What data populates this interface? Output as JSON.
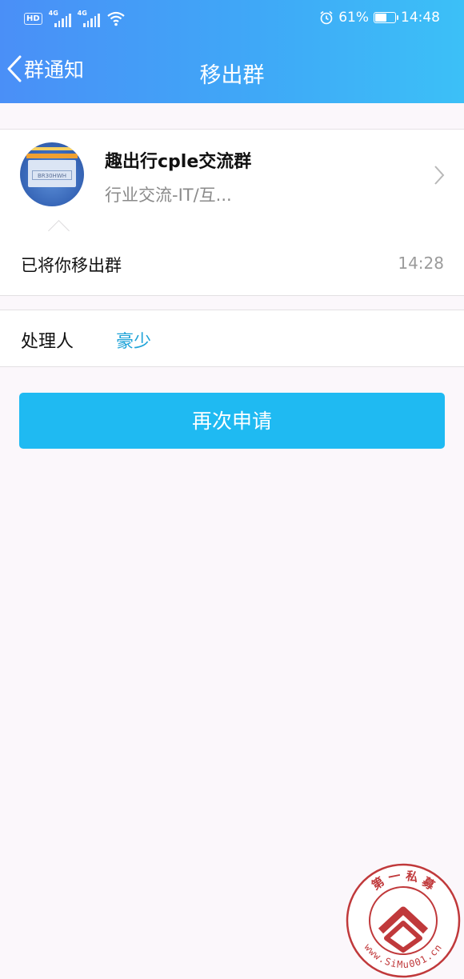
{
  "status_bar": {
    "hd_badge": "HD",
    "network_1": "4G",
    "network_2": "4G",
    "battery_percent": "61%",
    "battery_level": 0.61,
    "time": "14:48",
    "icons": [
      "alarm-icon",
      "wifi-icon",
      "battery-icon"
    ]
  },
  "nav": {
    "back_label": "群通知",
    "title": "移出群"
  },
  "group": {
    "name": "趣出行cple交流群",
    "category": "行业交流-IT/互...",
    "avatar_code": "BR30HWH"
  },
  "notice": {
    "message": "已将你移出群",
    "time": "14:28"
  },
  "handler": {
    "label": "处理人",
    "name": "豪少"
  },
  "actions": {
    "reapply_label": "再次申请"
  },
  "watermark": {
    "text_top": "第 一 私 募",
    "text_bottom": "www.SiMu001.cn"
  },
  "colors": {
    "header_gradient": [
      "#4a8ff7",
      "#3cc0f7"
    ],
    "button": "#1fbaf2",
    "link": "#1ea3d8",
    "background": "#fbf7fb",
    "watermark": "#c0393b"
  }
}
